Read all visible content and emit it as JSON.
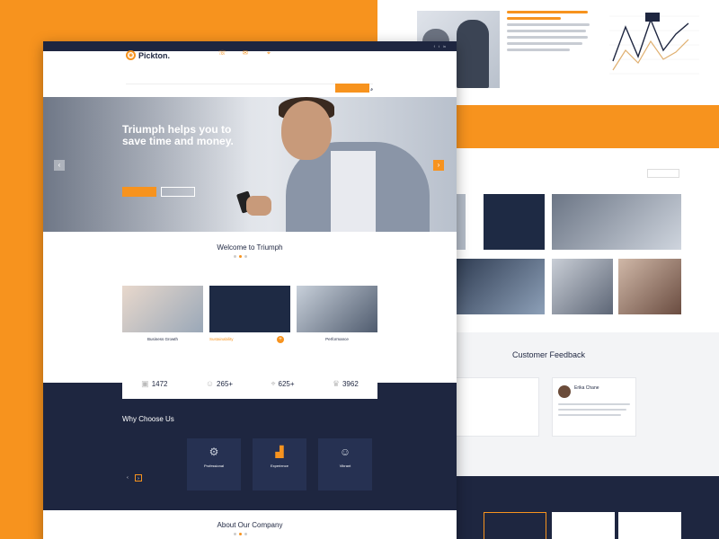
{
  "colors": {
    "accent": "#f7931e",
    "navy": "#1e2640",
    "white": "#ffffff"
  },
  "front": {
    "logo": {
      "name": "Pickton."
    },
    "hero": {
      "title": "Triumph helps you to save time and money."
    },
    "welcome_title": "Welcome to Triumph",
    "features": [
      {
        "label": "Business Growth"
      },
      {
        "label": "Sustainability"
      },
      {
        "label": "Performance"
      }
    ],
    "stats": [
      {
        "value": "1472",
        "icon": "briefcase-icon"
      },
      {
        "value": "265+",
        "icon": "user-icon"
      },
      {
        "value": "625+",
        "icon": "location-icon"
      },
      {
        "value": "3962",
        "icon": "trophy-icon"
      }
    ],
    "why": {
      "title": "Why Choose Us",
      "cards": [
        {
          "title": "Professional",
          "icon": "professional-icon"
        },
        {
          "title": "Experience",
          "icon": "chart-icon"
        },
        {
          "title": "Vibrant",
          "icon": "person-icon"
        }
      ]
    },
    "about_title": "About Our Company"
  },
  "back": {
    "feedback_title": "Customer Feedback",
    "feedback_names": [
      "Erika Chane"
    ]
  }
}
